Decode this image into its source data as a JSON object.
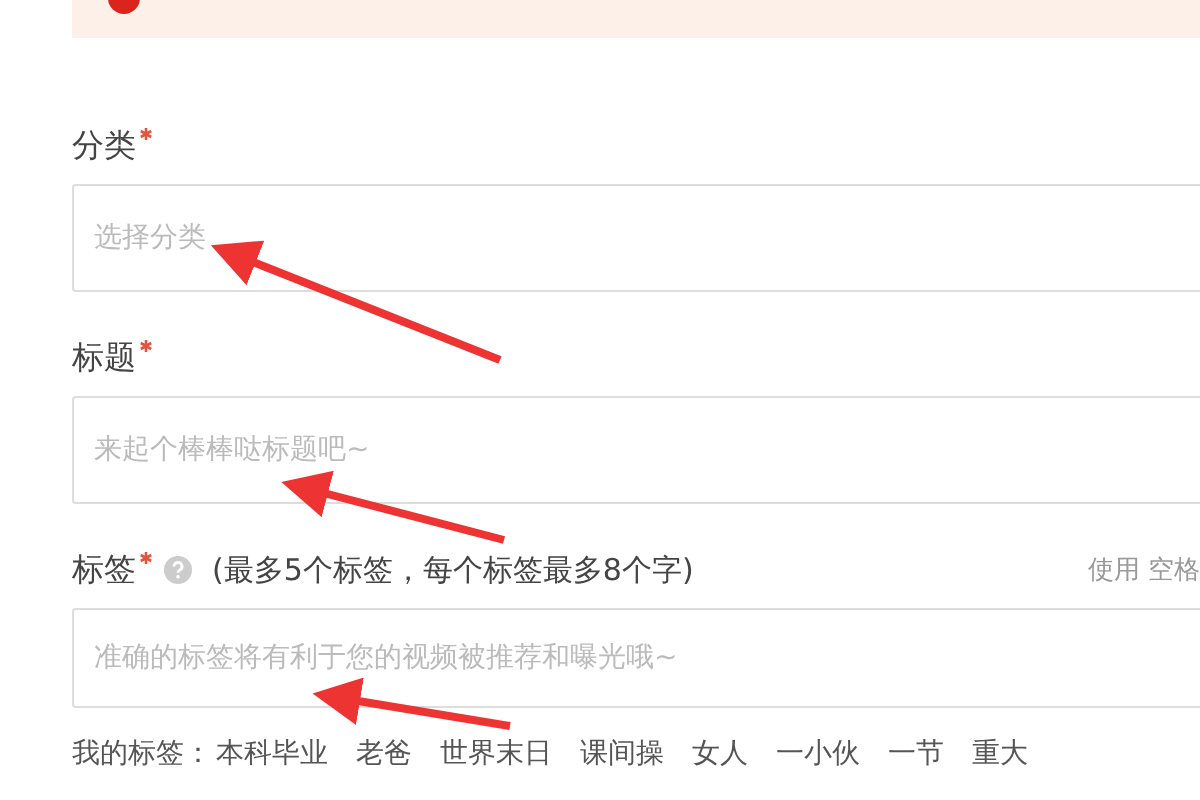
{
  "alert": {
    "kind": "error"
  },
  "fields": [
    {
      "label": "分类",
      "required": true,
      "placeholder": "选择分类"
    },
    {
      "label": "标题",
      "required": true,
      "placeholder": "来起个棒棒哒标题吧~"
    },
    {
      "label": "标签",
      "required": true,
      "help": true,
      "hint": "(最多5个标签，每个标签最多8个字)",
      "side_note": "使用 空格",
      "placeholder": "准确的标签将有利于您的视频被推荐和曝光哦~"
    }
  ],
  "my_tags": {
    "label": "我的标签：",
    "tags": [
      "本科毕业",
      "老爸",
      "世界末日",
      "课间操",
      "女人",
      "一小伙",
      "一节",
      "重大"
    ]
  }
}
